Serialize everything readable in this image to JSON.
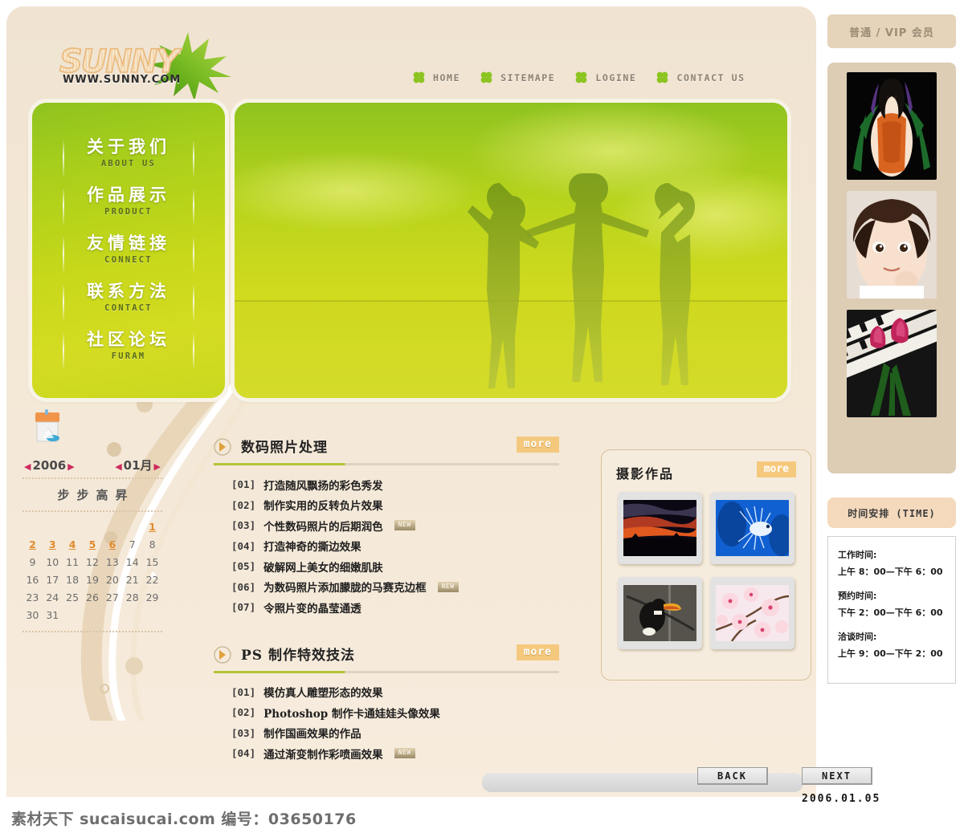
{
  "brand": {
    "logo_text": "SUNNY",
    "logo_url": "WWW.SUNNY.COM",
    "leaf_icon": "maple-leaf-icon"
  },
  "nav": {
    "items": [
      {
        "label": "HOME",
        "icon": "clover-icon"
      },
      {
        "label": "SITEMAPE",
        "icon": "clover-icon"
      },
      {
        "label": "LOGINE",
        "icon": "clover-icon"
      },
      {
        "label": "CONTACT US",
        "icon": "clover-icon"
      }
    ]
  },
  "sidenav": {
    "items": [
      {
        "cn": "关于我们",
        "en": "ABOUT US"
      },
      {
        "cn": "作品展示",
        "en": "PRODUCT"
      },
      {
        "cn": "友情链接",
        "en": "CONNECT"
      },
      {
        "cn": "联系方法",
        "en": "CONTACT"
      },
      {
        "cn": "社区论坛",
        "en": "FURAM"
      }
    ]
  },
  "calendar": {
    "icon": "calendar-desk-icon",
    "year": "2006",
    "month": "01月",
    "prev_arrow": "◀",
    "next_arrow": "▶",
    "motto": "步步高昇",
    "weeks": [
      [
        "",
        "",
        "",
        "",
        "",
        "",
        "1"
      ],
      [
        "2",
        "3",
        "4",
        "5",
        "6",
        "7",
        "8"
      ],
      [
        "9",
        "10",
        "11",
        "12",
        "13",
        "14",
        "15"
      ],
      [
        "16",
        "17",
        "18",
        "19",
        "20",
        "21",
        "22"
      ],
      [
        "23",
        "24",
        "25",
        "26",
        "27",
        "28",
        "29"
      ],
      [
        "30",
        "31",
        "",
        "",
        "",
        "",
        ""
      ]
    ],
    "highlighted_days": [
      "1",
      "2",
      "3",
      "4",
      "5",
      "6"
    ]
  },
  "sections": [
    {
      "title": "数码照片处理",
      "more_label": "more",
      "arrow_icon": "arrow-right-circle-icon",
      "items": [
        {
          "idx": "[01]",
          "text": "打造随风飘扬的彩色秀发",
          "new": false
        },
        {
          "idx": "[02]",
          "text": "制作实用的反转负片效果",
          "new": false
        },
        {
          "idx": "[03]",
          "text": "个性数码照片的后期润色",
          "new": true
        },
        {
          "idx": "[04]",
          "text": "打造神奇的撕边效果",
          "new": false
        },
        {
          "idx": "[05]",
          "text": "破解网上美女的细嫩肌肤",
          "new": false
        },
        {
          "idx": "[06]",
          "text": "为数码照片添加朦胧的马赛克边框",
          "new": true
        },
        {
          "idx": "[07]",
          "text": "令照片变的晶莹通透",
          "new": false
        }
      ]
    },
    {
      "title": "PS 制作特效技法",
      "more_label": "more",
      "arrow_icon": "arrow-right-circle-icon",
      "items": [
        {
          "idx": "[01]",
          "text": "模仿真人雕塑形态的效果",
          "new": false
        },
        {
          "idx": "[02]",
          "text": "Photoshop 制作卡通娃娃头像效果",
          "new": false
        },
        {
          "idx": "[03]",
          "text": "制作国画效果的作品",
          "new": false
        },
        {
          "idx": "[04]",
          "text": "通过渐变制作彩喷画效果",
          "new": true
        }
      ]
    }
  ],
  "gallery": {
    "title": "摄影作品",
    "more_label": "more",
    "thumbs": [
      {
        "name": "sunset-clouds-photo"
      },
      {
        "name": "lionfish-underwater-photo"
      },
      {
        "name": "toucan-bird-photo"
      },
      {
        "name": "cherry-blossom-photo"
      }
    ]
  },
  "footer": {
    "back_label": "BACK",
    "next_label": "NEXT",
    "date": "2006.01.05"
  },
  "right": {
    "vip_label": "普通 / VIP 会员",
    "strip_images": [
      {
        "name": "woman-orange-dress-photo"
      },
      {
        "name": "girl-portrait-photo"
      },
      {
        "name": "tulips-piano-photo"
      }
    ],
    "time_header": "时间安排 (TIME)",
    "time_groups": [
      {
        "label": "工作时间:",
        "value": "上午 8：00—下午 6：00"
      },
      {
        "label": "预约时间:",
        "value": "下午 2：00—下午 6：00"
      },
      {
        "label": "洽谈时间:",
        "value": "上午 9：00—下午 2：00"
      }
    ]
  },
  "watermark": "素材天下 sucaisucai.com  编号：03650176",
  "colors": {
    "page_bg": "#f4e7d5",
    "green_accent": "#a9cf1b",
    "more_button": "#f5c97d",
    "calendar_link": "#e08b2e",
    "right_panel": "#ddcdb5",
    "time_header_bg": "#f4d9bc"
  }
}
